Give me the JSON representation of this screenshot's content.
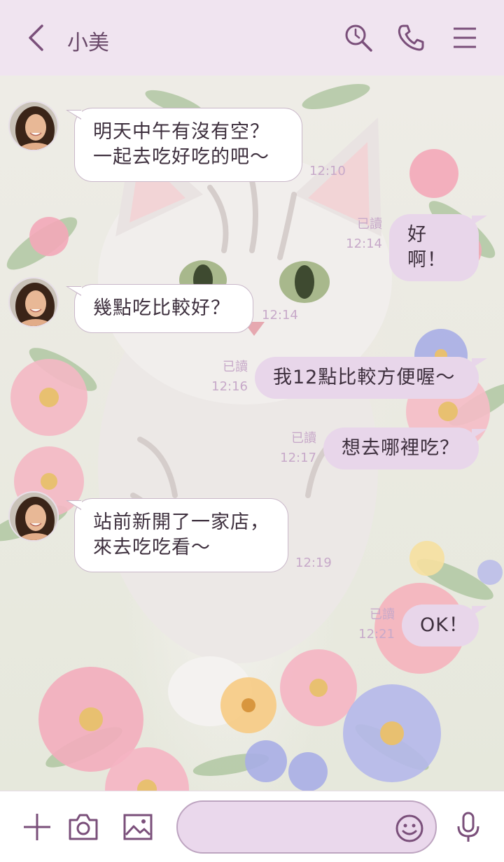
{
  "header": {
    "title": "小美",
    "icons": [
      "back-chevron-icon",
      "search-icon",
      "phone-icon",
      "menu-icon"
    ]
  },
  "messages": [
    {
      "side": "in",
      "lines": [
        "明天中午有沒有空？",
        "一起去吃好吃的吧～"
      ],
      "time": "12:10"
    },
    {
      "side": "out",
      "text": "好啊！",
      "read": "已讀",
      "time": "12:14"
    },
    {
      "side": "in",
      "text": "幾點吃比較好？",
      "time": "12:14"
    },
    {
      "side": "out",
      "text": "我12點比較方便喔～",
      "read": "已讀",
      "time": "12:16"
    },
    {
      "side": "out",
      "text": "想去哪裡吃？",
      "read": "已讀",
      "time": "12:17"
    },
    {
      "side": "in",
      "lines": [
        "站前新開了一家店，",
        "來去吃吃看～"
      ],
      "time": "12:19"
    },
    {
      "side": "out",
      "text": "OK！",
      "read": "已讀",
      "time": "12:21"
    }
  ],
  "composer": {
    "placeholder": "",
    "icons": [
      "plus-icon",
      "camera-icon",
      "image-icon",
      "emoji-icon",
      "microphone-icon"
    ]
  },
  "colors": {
    "header_bg": "#f0e4f0",
    "accent": "#7a4f7a",
    "outgoing_bubble": "#e8d6ea",
    "incoming_bubble": "#ffffff",
    "meta_text": "#c7a9c9"
  }
}
